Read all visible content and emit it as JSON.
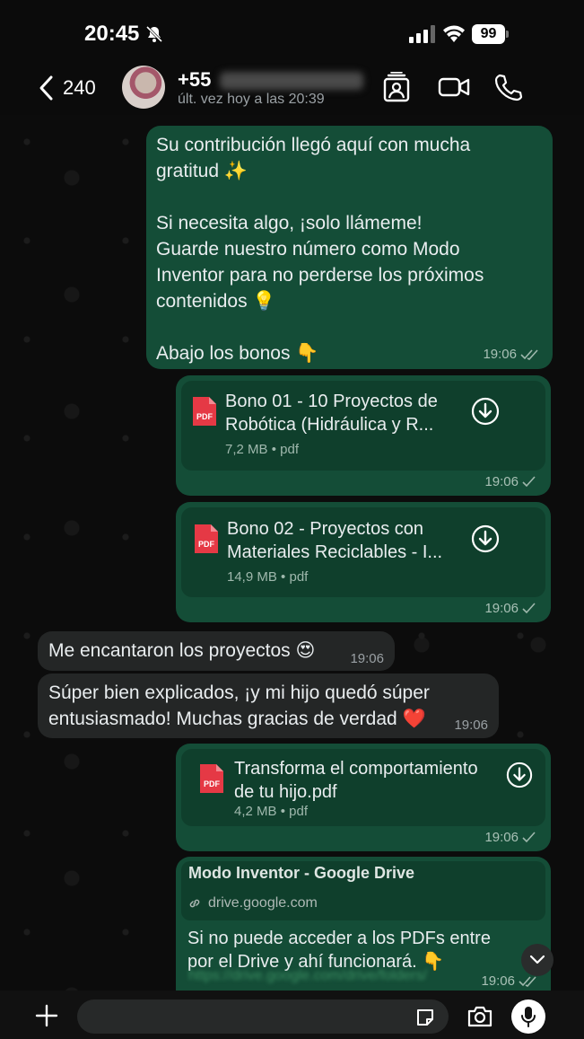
{
  "status_bar": {
    "time": "20:45",
    "battery": "99"
  },
  "header": {
    "back_count": "240",
    "contact_name": "+55",
    "contact_status": "últ. vez hoy a las 20:39"
  },
  "messages": [
    {
      "direction": "out",
      "text": "Su contribución llegó aquí con mucha\ngratitud ✨\n\nSi necesita algo, ¡solo llámeme!\nGuarde nuestro número como Modo\nInventor para no perderse los próximos\ncontenidos 💡\n\nAbajo los bonos 👇",
      "time": "19:06"
    },
    {
      "direction": "out",
      "doc_title": "Bono 01 - 10 Proyectos de\nRobótica (Hidráulica y R...",
      "doc_size": "7,2 MB",
      "doc_type": "pdf",
      "time": "19:06"
    },
    {
      "direction": "out",
      "doc_title": "Bono 02 - Proyectos con\nMateriales Reciclables - I...",
      "doc_size": "14,9 MB",
      "doc_type": "pdf",
      "time": "19:06"
    },
    {
      "direction": "in",
      "text": "Me encantaron los proyectos 😍",
      "time": "19:06"
    },
    {
      "direction": "in",
      "text": "Súper bien explicados, ¡y mi hijo quedó súper\nentusiasmado! Muchas gracias de verdad ❤️",
      "time": "19:06"
    },
    {
      "direction": "out",
      "doc_title": "Transforma el comportamiento\nde tu hijo.pdf",
      "doc_size": "4,2 MB",
      "doc_type": "pdf",
      "time": "19:06"
    },
    {
      "direction": "out",
      "link_title": "Modo Inventor - Google Drive",
      "link_domain": "drive.google.com",
      "text": "Si no puede acceder a los PDFs entre\npor el Drive y ahí funcionará. 👇",
      "link_url": "https://drive.google.com/drive/folders/",
      "time": "19:06"
    }
  ],
  "pdf_badge": "PDF",
  "separator": "•",
  "colors": {
    "outgoing_bubble": "#144d37",
    "incoming_bubble": "#242626",
    "doc_inner": "#0f3f2c",
    "pdf_red": "#e53945",
    "link_green": "#3c8f63"
  },
  "icons": [
    "bell-off-icon",
    "signal-icon",
    "wifi-icon",
    "back-chevron-icon",
    "contact-card-icon",
    "video-call-icon",
    "phone-icon",
    "pdf-icon",
    "download-icon",
    "double-check-icon",
    "check-icon",
    "link-icon",
    "chevron-down-icon",
    "plus-icon",
    "sticker-icon",
    "camera-icon",
    "mic-icon"
  ]
}
